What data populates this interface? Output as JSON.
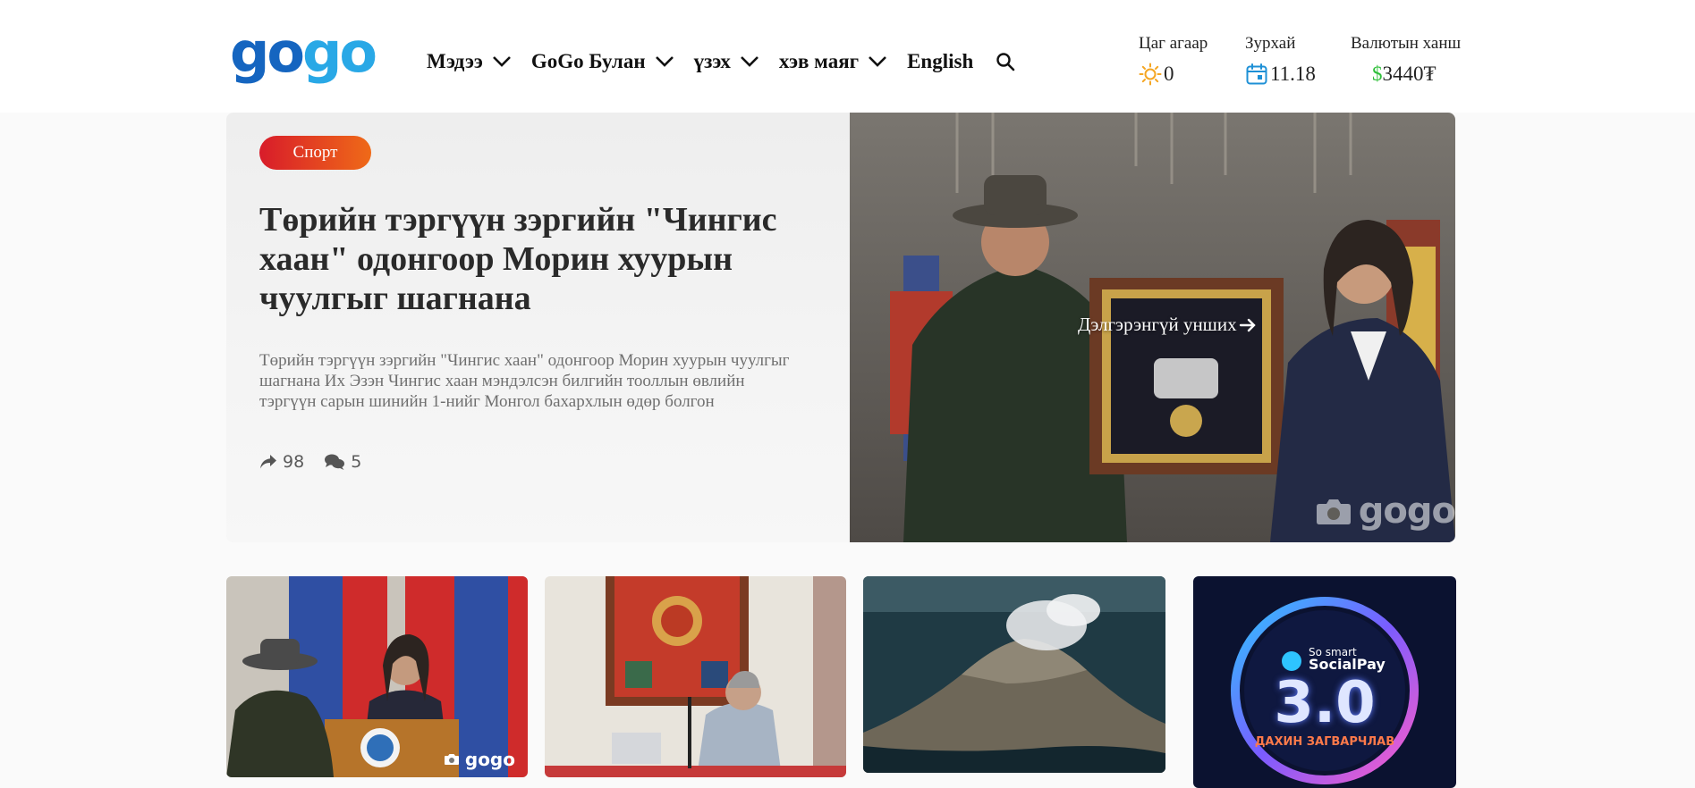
{
  "logo": {
    "part1": "go",
    "part2": "go"
  },
  "nav": {
    "items": [
      {
        "label": "Мэдээ",
        "has_dropdown": true
      },
      {
        "label": "GoGo Булан",
        "has_dropdown": true
      },
      {
        "label": "үзэх",
        "has_dropdown": true
      },
      {
        "label": "хэв маяг",
        "has_dropdown": true
      },
      {
        "label": "English",
        "has_dropdown": false
      }
    ],
    "search_icon": "search-icon"
  },
  "widgets": {
    "weather": {
      "label": "Цаг агаар",
      "value": "0",
      "icon": "sun-icon"
    },
    "horoscope": {
      "label": "Зурхай",
      "value": "11.18",
      "icon": "calendar-icon"
    },
    "currency": {
      "label": "Валютын ханш",
      "symbol": "$",
      "value": "3440₮"
    }
  },
  "hero": {
    "category": "Спорт",
    "title": "Төрийн тэргүүн зэргийн \"Чингис хаан\" одонгоор Морин хуурын чуулгыг шагнана",
    "description": "Төрийн тэргүүн зэргийн \"Чингис хаан\" одонгоор Морин хуурын чуулгыг шагнана Их Эзэн Чингис хаан мэндэлсэн билгийн тооллын өвлийн тэргүүн сарын шинийн 1-нийг Монгол бахархлын өдөр болгон",
    "shares": "98",
    "comments": "5",
    "read_more": "Дэлгэрэнгүй унших",
    "watermark": "gogo"
  },
  "cards": [
    {
      "watermark": "gogo",
      "image": "speech-at-podium"
    },
    {
      "watermark": "",
      "image": "speaker-with-laptop"
    },
    {
      "watermark": "",
      "image": "volcanic-island"
    },
    {
      "watermark": "",
      "image": "socialpay-ad",
      "ad_brand_small": "So smart",
      "ad_brand": "SocialPay",
      "ad_big": "3.0",
      "ad_sub": "ДАХИН ЗАГВАРЧЛАВ"
    }
  ],
  "colors": {
    "logo_dark": "#1565c0",
    "logo_light": "#29a8e6",
    "badge_start": "#d81c2a",
    "badge_end": "#ef6a18",
    "currency_green": "#2fbf3a",
    "sun": "#f5a623",
    "calendar": "#1e90d6"
  }
}
